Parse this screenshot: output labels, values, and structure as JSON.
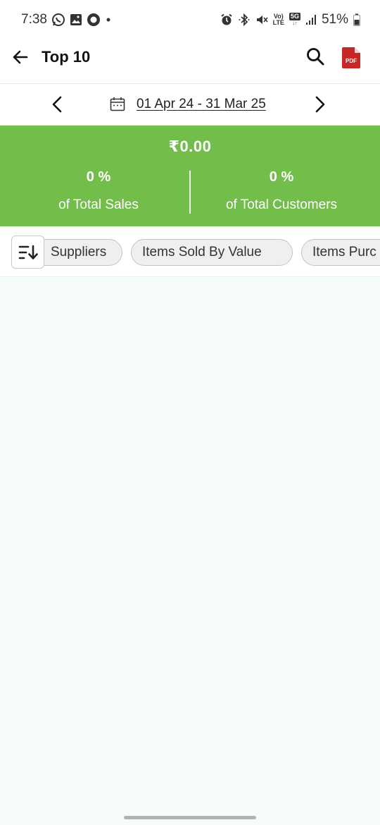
{
  "status_bar": {
    "time": "7:38",
    "volte_top": "Vo)",
    "volte_bottom": "LTE",
    "network": "5G",
    "battery": "51%",
    "icons": [
      "whatsapp-icon",
      "gallery-icon",
      "circle-app-icon",
      "dot-icon",
      "alarm-icon",
      "bluetooth-icon",
      "mute-icon",
      "volte-icon",
      "5g-icon",
      "signal-icon",
      "battery-icon"
    ]
  },
  "header": {
    "title": "Top 10",
    "back_icon": "arrow-left-icon",
    "search_icon": "search-icon",
    "pdf_label": "PDF"
  },
  "date_bar": {
    "range": "01 Apr 24 - 31 Mar 25",
    "prev_icon": "chevron-left-icon",
    "next_icon": "chevron-right-icon",
    "calendar_icon": "calendar-icon"
  },
  "summary": {
    "total": "₹0.00",
    "sales_percent": "0 %",
    "sales_label": "of Total Sales",
    "customers_percent": "0 %",
    "customers_label": "of Total Customers",
    "color": "#73bd4b"
  },
  "filters": {
    "sort_icon": "sort-icon",
    "chips": [
      "Suppliers",
      "Items Sold By Value",
      "Items Purc"
    ]
  }
}
